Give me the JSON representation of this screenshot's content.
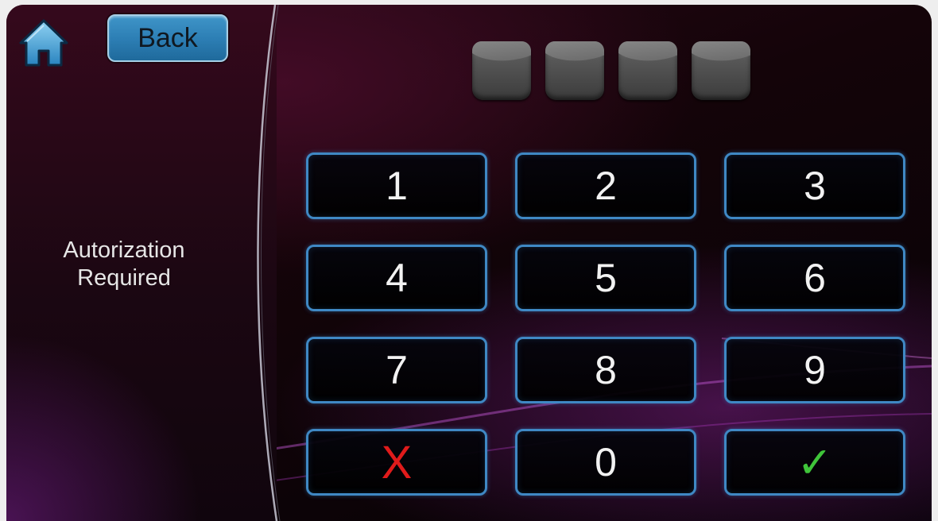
{
  "header": {
    "home_icon": "home-icon",
    "back_label": "Back"
  },
  "prompt": {
    "line1": "Autorization",
    "line2": "Required"
  },
  "pin": {
    "length": 4,
    "entered": 0
  },
  "keypad": {
    "keys": [
      {
        "label": "1"
      },
      {
        "label": "2"
      },
      {
        "label": "3"
      },
      {
        "label": "4"
      },
      {
        "label": "5"
      },
      {
        "label": "6"
      },
      {
        "label": "7"
      },
      {
        "label": "8"
      },
      {
        "label": "9"
      },
      {
        "label": "X",
        "icon": "cancel-icon"
      },
      {
        "label": "0"
      },
      {
        "label": "✓",
        "icon": "checkmark-icon"
      }
    ]
  },
  "colors": {
    "key_border": "#3f88c4",
    "back_button": "#2d7fb5",
    "cancel": "#e01b1b",
    "confirm": "#3fc43a"
  }
}
